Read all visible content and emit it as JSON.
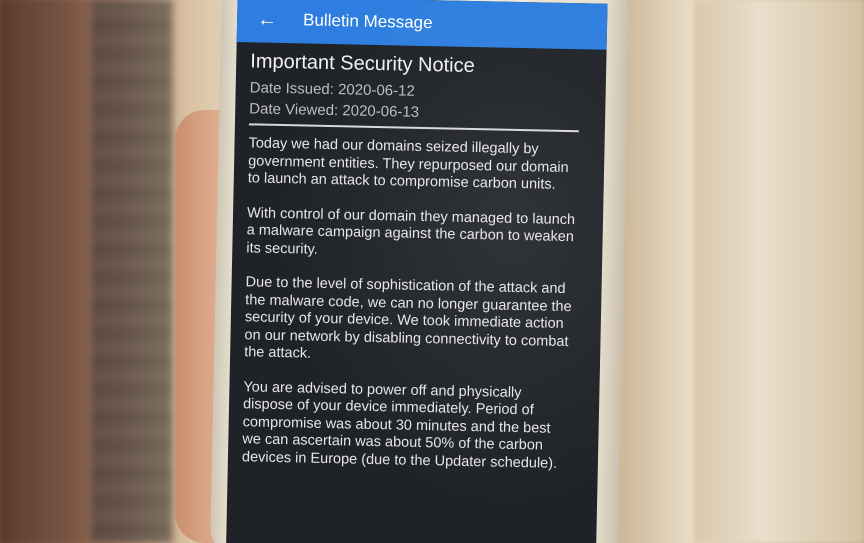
{
  "header": {
    "back_icon": "←",
    "title": "Bulletin Message"
  },
  "notice": {
    "title": "Important Security Notice",
    "date_issued": "Date Issued: 2020-06-12",
    "date_viewed": "Date Viewed: 2020-06-13",
    "paragraphs": [
      "Today we had our domains seized illegally by government entities. They repurposed our domain to launch an attack to compromise carbon units.",
      "With control of our domain they managed to launch a malware campaign against the carbon to weaken its security.",
      "Due to the level of sophistication of the attack and the malware code, we can no longer guarantee the security of your device. We took immediate action on our network by disabling connectivity to combat the attack.",
      "You are advised to power off and physically dispose of your device immediately. Period of compromise was about 30 minutes and the best we can ascertain was about 50% of the carbon devices in Europe (due to the Updater schedule)."
    ]
  },
  "colors": {
    "header_bg": "#2d7ee0",
    "screen_bg": "#1f2226"
  }
}
